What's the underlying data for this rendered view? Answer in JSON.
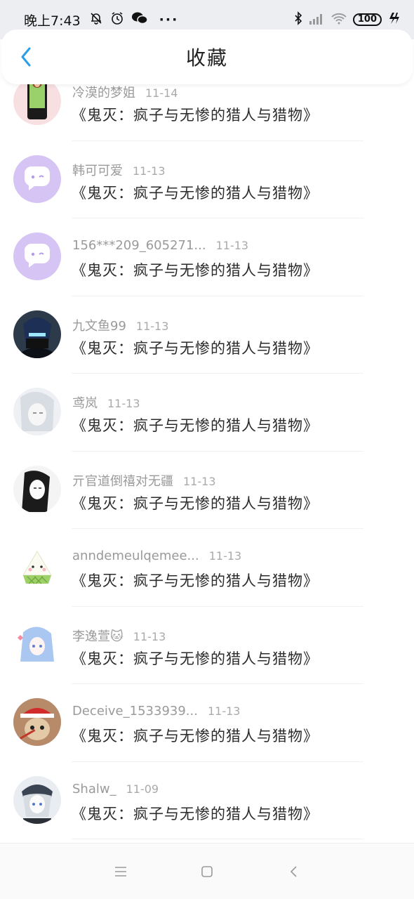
{
  "status_bar": {
    "time": "晚上7:43",
    "dots": "···",
    "battery": "100",
    "icons": [
      "bell-off-icon",
      "alarm-icon",
      "wechat-icon",
      "bluetooth-icon",
      "signal-icon",
      "wifi-icon",
      "charging-icon"
    ]
  },
  "header": {
    "title": "收藏",
    "back_icon": "chevron-left-icon"
  },
  "items": [
    {
      "user": "冷漠的梦姐",
      "date": "11-14",
      "work": "《鬼灭：疯子与无惨的猎人与猎物》"
    },
    {
      "user": "韩可可爱",
      "date": "11-13",
      "work": "《鬼灭：疯子与无惨的猎人与猎物》"
    },
    {
      "user": "156***209_605271...",
      "date": "11-13",
      "work": "《鬼灭：疯子与无惨的猎人与猎物》"
    },
    {
      "user": "九文鱼99",
      "date": "11-13",
      "work": "《鬼灭：疯子与无惨的猎人与猎物》"
    },
    {
      "user": "鸢岚",
      "date": "11-13",
      "work": "《鬼灭：疯子与无惨的猎人与猎物》"
    },
    {
      "user": "亓官道倒禧对无疆",
      "date": "11-13",
      "work": "《鬼灭：疯子与无惨的猎人与猎物》"
    },
    {
      "user": "anndemeulqemee...",
      "date": "11-13",
      "work": "《鬼灭：疯子与无惨的猎人与猎物》"
    },
    {
      "user": "李逸萱🐱",
      "date": "11-13",
      "work": "《鬼灭：疯子与无惨的猎人与猎物》"
    },
    {
      "user": "Deceive_1533939...",
      "date": "11-13",
      "work": "《鬼灭：疯子与无惨的猎人与猎物》"
    },
    {
      "user": "Shalw_",
      "date": "11-09",
      "work": "《鬼灭：疯子与无惨的猎人与猎物》"
    }
  ],
  "nav": {
    "menu_icon": "menu-icon",
    "home_icon": "home-square-icon",
    "back_icon": "back-triangle-icon"
  }
}
